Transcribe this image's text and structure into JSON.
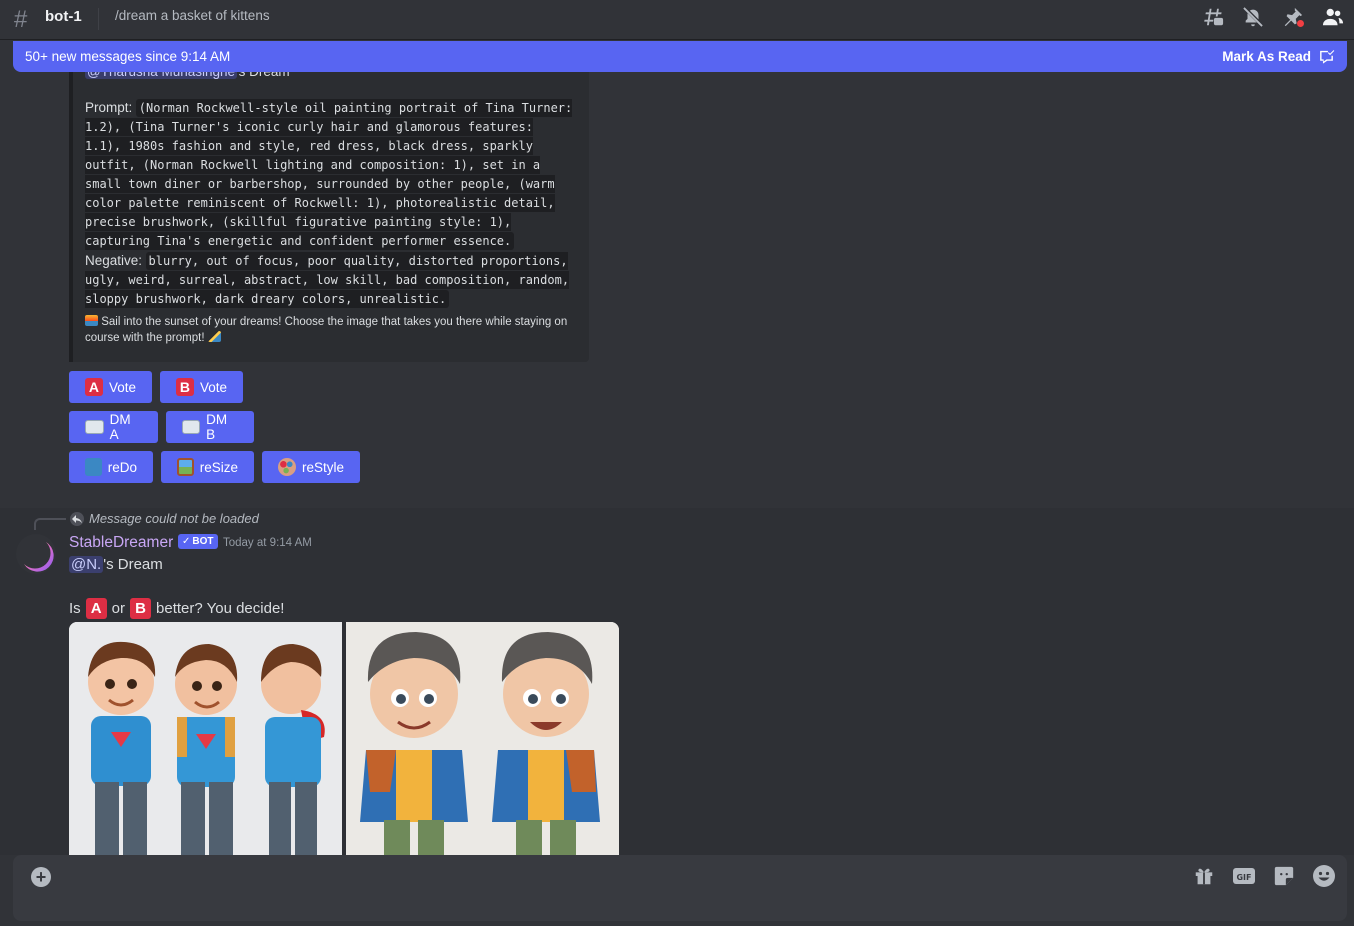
{
  "header": {
    "channel_symbol": "#",
    "channel_name": "bot-1",
    "topic": "/dream a basket of kittens",
    "icons": [
      "threads-icon",
      "mute-bell-icon",
      "pin-icon",
      "members-icon"
    ]
  },
  "new_messages_bar": {
    "text": "50+ new messages since 9:14 AM",
    "action": "Mark As Read"
  },
  "embed": {
    "mention_name": "@Tharusha Munasinghe",
    "mention_suffix": "'s Dream",
    "prompt_label": "Prompt:",
    "prompt_text": "(Norman Rockwell-style oil painting portrait of Tina Turner: 1.2), (Tina Turner's iconic curly hair and glamorous features: 1.1), 1980s fashion and style, red dress, black dress, sparkly outfit, (Norman Rockwell lighting and composition: 1), set in a small town diner or barbershop, surrounded by other people, (warm color palette reminiscent of Rockwell: 1), photorealistic detail, precise brushwork, (skillful figurative painting style: 1), capturing Tina's energetic and confident performer essence.",
    "negative_label": "Negative:",
    "negative_text": "blurry, out of focus, poor quality, distorted proportions, ugly, weird, surreal, abstract, low skill, bad composition, random, sloppy brushwork, dark dreary colors, unrealistic.",
    "footer_text": "Sail into the sunset of your dreams! Choose the image that takes you there while staying on course with the prompt!"
  },
  "buttons": {
    "vote_a_letter": "A",
    "vote_a": "Vote",
    "vote_b_letter": "B",
    "vote_b": "Vote",
    "dm_a": "DM A",
    "dm_b": "DM B",
    "redo": "reDo",
    "resize": "reSize",
    "restyle": "reStyle"
  },
  "message2": {
    "reply_text": "Message could not be loaded",
    "username": "StableDreamer",
    "bot_tag": "BOT",
    "bot_check": "✓",
    "timestamp": "Today at 9:14 AM",
    "mention": "@N.",
    "mention_suffix": "'s Dream",
    "line2_prefix": "Is",
    "letter_a": "A",
    "or_text": "or",
    "letter_b": "B",
    "line2_suffix": "better? You decide!"
  },
  "composer": {
    "icons": [
      "gift-icon",
      "gif-icon",
      "sticker-icon",
      "emoji-icon"
    ],
    "gif_label": "GIF"
  },
  "colors": {
    "background": "#313338",
    "accent": "#5865f2",
    "username": "#c9a7f5",
    "letter_red": "#dd2e44"
  }
}
